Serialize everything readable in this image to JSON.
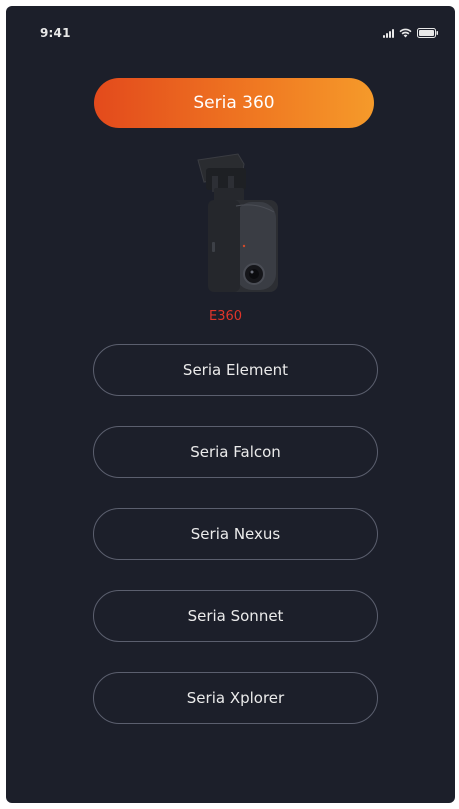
{
  "status_bar": {
    "time": "9:41"
  },
  "featured_series": {
    "label": "Seria 360",
    "accent_start": "#e34a1c",
    "accent_end": "#f59a2a"
  },
  "product": {
    "image": "dashcam-product-image",
    "model_label": "E360",
    "model_color": "#e0352a"
  },
  "series_options": [
    {
      "label": "Seria Element"
    },
    {
      "label": "Seria Falcon"
    },
    {
      "label": "Seria Nexus"
    },
    {
      "label": "Seria Sonnet"
    },
    {
      "label": "Seria Xplorer"
    }
  ],
  "colors": {
    "background": "#1c1f2a",
    "outline": "#5b5f6e",
    "text": "#ebebeb"
  }
}
